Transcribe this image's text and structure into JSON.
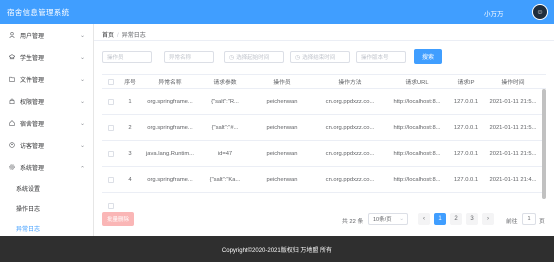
{
  "header": {
    "title": "宿舍信息管理系统",
    "username": "小万万",
    "avatar_glyph": "☺"
  },
  "sidebar": {
    "items": [
      {
        "label": "用户管理",
        "icon": "user-icon"
      },
      {
        "label": "学生管理",
        "icon": "student-icon"
      },
      {
        "label": "文件管理",
        "icon": "folder-icon"
      },
      {
        "label": "权限管理",
        "icon": "lock-icon"
      },
      {
        "label": "宿舍管理",
        "icon": "home-icon"
      },
      {
        "label": "访客管理",
        "icon": "visitor-icon"
      },
      {
        "label": "系统管理",
        "icon": "gear-icon"
      }
    ],
    "sub_items": [
      {
        "label": "系统设置"
      },
      {
        "label": "操作日志"
      },
      {
        "label": "异常日志"
      }
    ],
    "arrow": "⌄"
  },
  "breadcrumb": {
    "home": "首页",
    "separator": "/",
    "current": "异常日志"
  },
  "filters": {
    "operator_placeholder": "操作员",
    "exception_name_placeholder": "异常名称",
    "start_time_placeholder": "选择起始时间",
    "end_time_placeholder": "选择结束时间",
    "version_placeholder": "操作版本号",
    "search_label": "搜索"
  },
  "table": {
    "headers": [
      "序号",
      "异常名称",
      "请求参数",
      "操作员",
      "操作方法",
      "请求URL",
      "请求IP",
      "操作时间"
    ],
    "rows": [
      {
        "index": "1",
        "name": "org.springframe...",
        "params": "{\"salt\":\"R...",
        "operator": "peichenwan",
        "method": "cn.org.ppdxzz.co...",
        "url": "http://localhost:8...",
        "ip": "127.0.0.1",
        "time": "2021-01-11 21:5..."
      },
      {
        "index": "2",
        "name": "org.springframe...",
        "params": "{\"salt\":\"#...",
        "operator": "peichenwan",
        "method": "cn.org.ppdxzz.co...",
        "url": "http://localhost:8...",
        "ip": "127.0.0.1",
        "time": "2021-01-11 21:5..."
      },
      {
        "index": "3",
        "name": "java.lang.Runtim...",
        "params": "id=47",
        "operator": "peichenwan",
        "method": "cn.org.ppdxzz.co...",
        "url": "http://localhost:8...",
        "ip": "127.0.0.1",
        "time": "2021-01-11 21:5..."
      },
      {
        "index": "4",
        "name": "org.springframe...",
        "params": "{\"salt\":\"Ka...",
        "operator": "peichenwan",
        "method": "cn.org.ppdxzz.co...",
        "url": "http://localhost:8...",
        "ip": "127.0.0.1",
        "time": "2021-01-11 21:4..."
      }
    ]
  },
  "actions": {
    "batch_delete_label": "批量删除"
  },
  "pagination": {
    "total_label": "共 22 条",
    "page_size_label": "10条/页",
    "prev": "‹",
    "pages": [
      "1",
      "2",
      "3"
    ],
    "next": "›",
    "current_page": "1",
    "goto_label": "前往",
    "goto_value": "1",
    "page_suffix": "页"
  },
  "footer": {
    "text": "Copyright©2020-2021版权归 万地盟 所有"
  },
  "colors": {
    "primary": "#409eff",
    "footer_bg": "#2f2f2f",
    "danger_light": "#fab6b6"
  }
}
